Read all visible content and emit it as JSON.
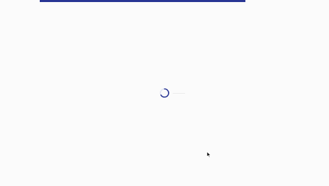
{
  "colors": {
    "background": "#fbfbfb",
    "accent": "#283593",
    "spinner": "#283593"
  },
  "progress": {
    "start_fraction": 0.12,
    "end_fraction": 0.745
  },
  "spinner": {
    "icon": "loading-spinner-icon",
    "state": "loading"
  },
  "cursor": {
    "icon": "mouse-pointer-icon"
  }
}
